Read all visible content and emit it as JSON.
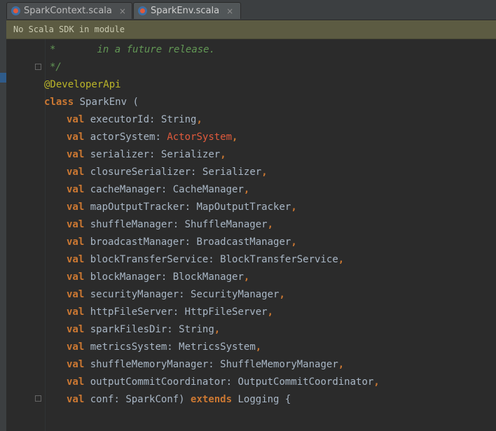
{
  "tabs": [
    {
      "label": "SparkContext.scala",
      "close": "×",
      "active": false
    },
    {
      "label": "SparkEnv.scala",
      "close": "×",
      "active": true
    }
  ],
  "banner": {
    "text": "No Scala SDK in module"
  },
  "code": {
    "comment1_star": "*",
    "comment1_text": "in a future release.",
    "comment_end": "*/",
    "annotation": "@DeveloperApi",
    "class_kw": "class",
    "class_decl": " SparkEnv (",
    "val_kw": "val",
    "params": [
      {
        "name": "executorId: ",
        "type": "String",
        "sep": ","
      },
      {
        "name": "actorSystem: ",
        "type": "ActorSystem",
        "sep": ","
      },
      {
        "name": "serializer: ",
        "type": "Serializer",
        "sep": ","
      },
      {
        "name": "closureSerializer: ",
        "type": "Serializer",
        "sep": ","
      },
      {
        "name": "cacheManager: ",
        "type": "CacheManager",
        "sep": ","
      },
      {
        "name": "mapOutputTracker: ",
        "type": "MapOutputTracker",
        "sep": ","
      },
      {
        "name": "shuffleManager: ",
        "type": "ShuffleManager",
        "sep": ","
      },
      {
        "name": "broadcastManager: ",
        "type": "BroadcastManager",
        "sep": ","
      },
      {
        "name": "blockTransferService: ",
        "type": "BlockTransferService",
        "sep": ","
      },
      {
        "name": "blockManager: ",
        "type": "BlockManager",
        "sep": ","
      },
      {
        "name": "securityManager: ",
        "type": "SecurityManager",
        "sep": ","
      },
      {
        "name": "httpFileServer: ",
        "type": "HttpFileServer",
        "sep": ","
      },
      {
        "name": "sparkFilesDir: ",
        "type": "String",
        "sep": ","
      },
      {
        "name": "metricsSystem: ",
        "type": "MetricsSystem",
        "sep": ","
      },
      {
        "name": "shuffleMemoryManager: ",
        "type": "ShuffleMemoryManager",
        "sep": ","
      },
      {
        "name": "outputCommitCoordinator: ",
        "type": "OutputCommitCoordinator",
        "sep": ","
      }
    ],
    "last_param_name": "conf: ",
    "last_param_type": "SparkConf) ",
    "extends_kw": "extends",
    "extends_rest": " Logging {"
  },
  "colors": {
    "keyword": "#cc7832",
    "annotation": "#bbb529",
    "comment": "#629755",
    "error_type": "#e05a3c",
    "text": "#a9b7c6",
    "banner_bg": "#5c5b42"
  },
  "icons": {
    "tab_file": "scala-file-icon",
    "tab_close": "close-icon",
    "fold": "fold-marker-icon"
  }
}
